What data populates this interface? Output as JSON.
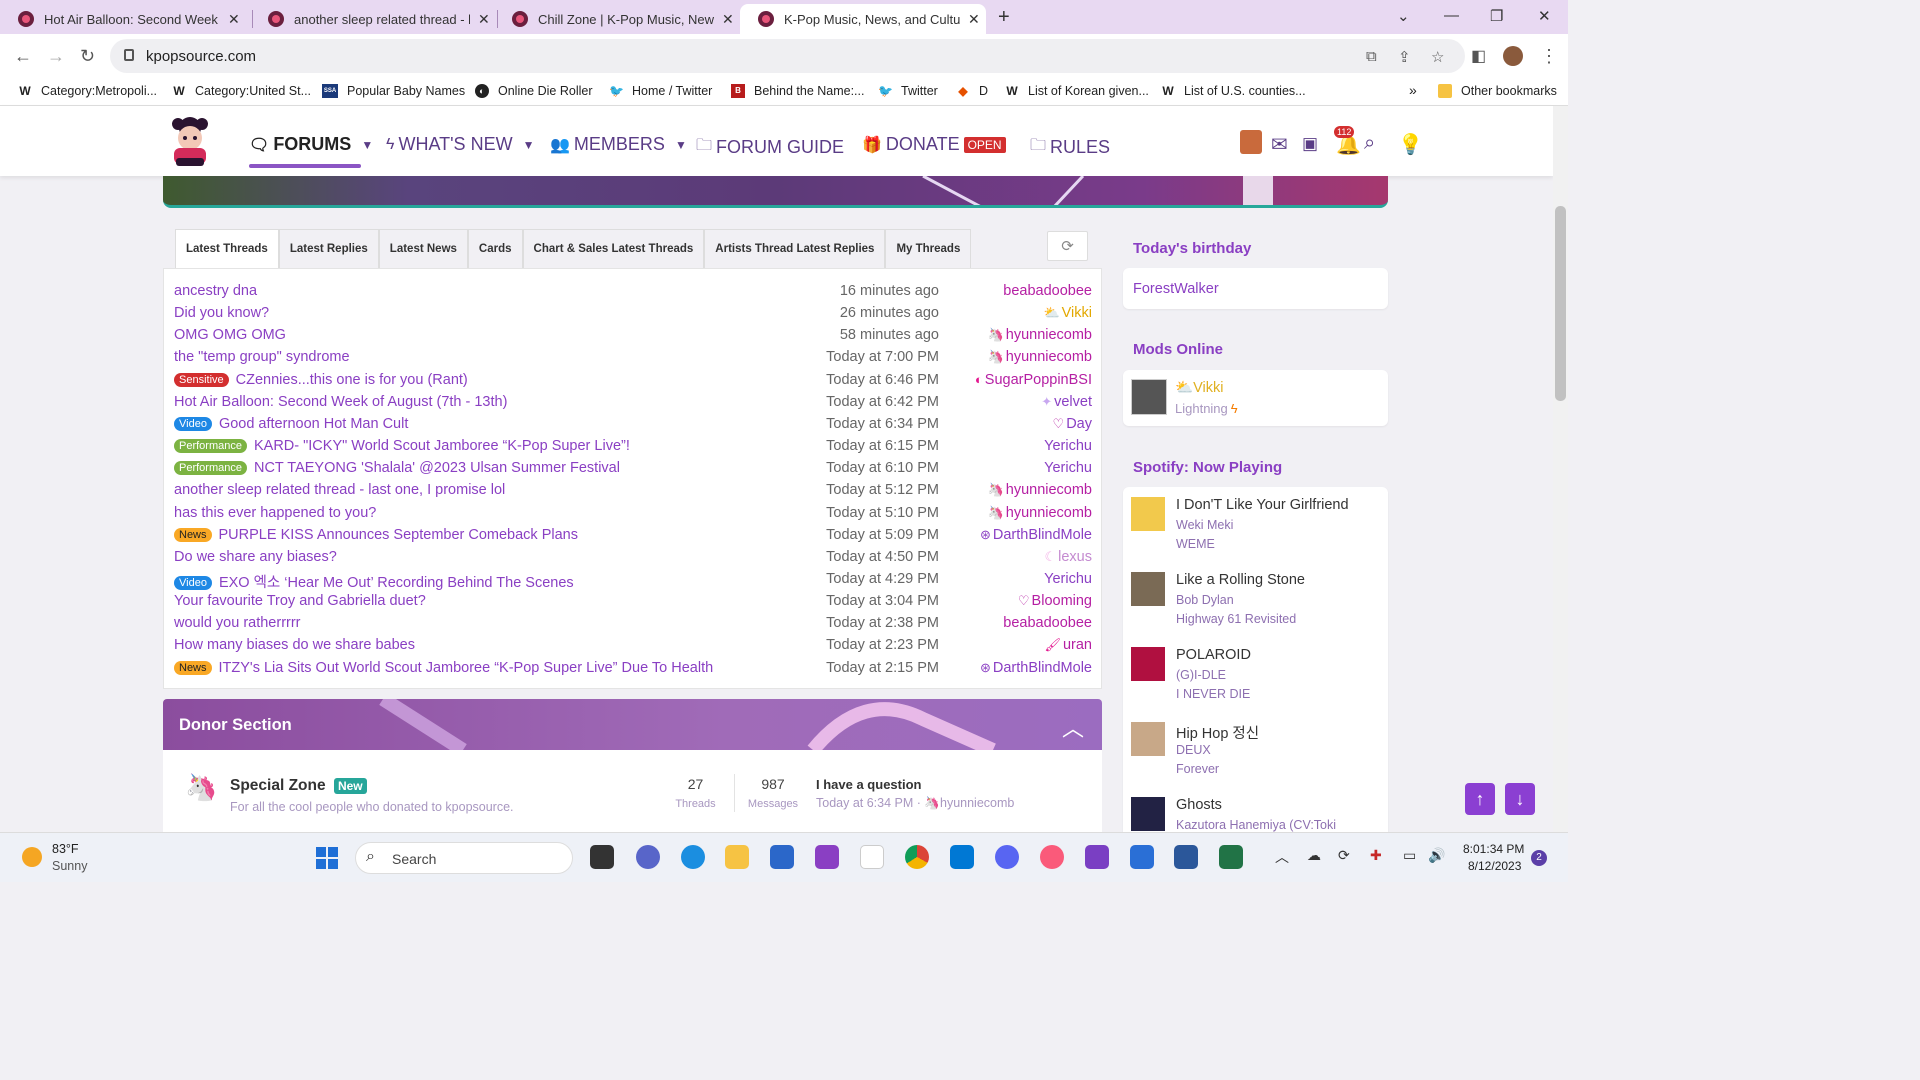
{
  "browser": {
    "tabs": [
      {
        "title": "Hot Air Balloon: Second Week of",
        "active": false
      },
      {
        "title": "another sleep related thread - las",
        "active": false
      },
      {
        "title": "Chill Zone | K-Pop Music, News, a",
        "active": false
      },
      {
        "title": "K-Pop Music, News, and Culture",
        "active": true
      }
    ],
    "new_tab": "+",
    "url": "kpopsource.com",
    "bookmarks": [
      {
        "icon": "W",
        "label": "Category:Metropoli..."
      },
      {
        "icon": "W",
        "label": "Category:United St..."
      },
      {
        "icon": "SSA",
        "label": "Popular Baby Names"
      },
      {
        "icon": "die-icon",
        "label": "Online Die Roller"
      },
      {
        "icon": "twitter-icon",
        "label": "Home / Twitter"
      },
      {
        "icon": "btn-icon",
        "label": "Behind the Name:..."
      },
      {
        "icon": "twitter-icon",
        "label": "Twitter"
      },
      {
        "icon": "d-icon",
        "label": "D"
      },
      {
        "icon": "W",
        "label": "List of Korean given..."
      },
      {
        "icon": "W",
        "label": "List of U.S. counties..."
      }
    ],
    "bookmarks_more": "»",
    "other_bookmarks": "Other bookmarks"
  },
  "site": {
    "nav": {
      "forums": "FORUMS",
      "whats_new": "WHAT'S NEW",
      "members": "MEMBERS",
      "forum_guide": "FORUM GUIDE",
      "donate": "DONATE",
      "donate_badge": "OPEN",
      "rules": "RULES"
    },
    "notification_count": "112",
    "accent_color": "#8a3fc3"
  },
  "threads": {
    "tabs": [
      "Latest Threads",
      "Latest Replies",
      "Latest News",
      "Cards",
      "Chart & Sales Latest Threads",
      "Artists Thread Latest Replies",
      "My Threads"
    ],
    "refresh_icon": "refresh-icon",
    "rows": [
      {
        "badge": "",
        "title": "ancestry dna",
        "time": "16 minutes ago",
        "user": "beabadoobee",
        "user_icon": ""
      },
      {
        "badge": "",
        "title": "Did you know?",
        "time": "26 minutes ago",
        "user": "Vikki",
        "user_icon": "sun-cloud-icon"
      },
      {
        "badge": "",
        "title": "OMG OMG OMG",
        "time": "58 minutes ago",
        "user": "hyunniecomb",
        "user_icon": "unicorn-icon"
      },
      {
        "badge": "",
        "title": "the \"temp group\" syndrome",
        "time": "Today at 7:00 PM",
        "user": "hyunniecomb",
        "user_icon": "unicorn-icon"
      },
      {
        "badge": "Sensitive",
        "title": "CZennies...this one is for you (Rant)",
        "time": "Today at 6:46 PM",
        "user": "SugarPoppinBSI",
        "user_icon": "swirl-icon"
      },
      {
        "badge": "",
        "title": "Hot Air Balloon: Second Week of August (7th - 13th)",
        "time": "Today at 6:42 PM",
        "user": "velvet",
        "user_icon": "star-icon"
      },
      {
        "badge": "Video",
        "title": "Good afternoon Hot Man Cult",
        "time": "Today at 6:34 PM",
        "user": "Day",
        "user_icon": "heart-icon"
      },
      {
        "badge": "Performance",
        "title": "KARD- \"ICKY\" World Scout Jamboree “K-Pop Super Live”!",
        "time": "Today at 6:15 PM",
        "user": "Yerichu",
        "user_icon": ""
      },
      {
        "badge": "Performance",
        "title": "NCT TAEYONG 'Shalala' @2023 Ulsan Summer Festival",
        "time": "Today at 6:10 PM",
        "user": "Yerichu",
        "user_icon": ""
      },
      {
        "badge": "",
        "title": "another sleep related thread - last one, I promise lol",
        "time": "Today at 5:12 PM",
        "user": "hyunniecomb",
        "user_icon": "unicorn-icon"
      },
      {
        "badge": "",
        "title": "has this ever happened to you?",
        "time": "Today at 5:10 PM",
        "user": "hyunniecomb",
        "user_icon": "unicorn-icon"
      },
      {
        "badge": "News",
        "title": "PURPLE KISS Announces September Comeback Plans",
        "time": "Today at 5:09 PM",
        "user": "DarthBlindMole",
        "user_icon": "empire-icon"
      },
      {
        "badge": "",
        "title": "Do we share any biases?",
        "time": "Today at 4:50 PM",
        "user": "lexus",
        "user_icon": "moon-icon"
      },
      {
        "badge": "Video",
        "title": "EXO 엑소 ‘Hear Me Out’ Recording Behind The Scenes",
        "time": "Today at 4:29 PM",
        "user": "Yerichu",
        "user_icon": ""
      },
      {
        "badge": "",
        "title": "Your favourite Troy and Gabriella duet?",
        "time": "Today at 3:04 PM",
        "user": "Blooming",
        "user_icon": "heart-icon"
      },
      {
        "badge": "",
        "title": "would you ratherrrrr",
        "time": "Today at 2:38 PM",
        "user": "beabadoobee",
        "user_icon": ""
      },
      {
        "badge": "",
        "title": "How many biases do we share babes",
        "time": "Today at 2:23 PM",
        "user": "uran",
        "user_icon": "wand-icon"
      },
      {
        "badge": "News",
        "title": "ITZY's Lia Sits Out World Scout Jamboree “K-Pop Super Live” Due To Health",
        "time": "Today at 2:15 PM",
        "user": "DarthBlindMole",
        "user_icon": "empire-icon"
      }
    ]
  },
  "donor": {
    "title": "Donor Section",
    "forum": {
      "name": "Special Zone",
      "badge": "New",
      "desc": "For all the cool people who donated to kpopsource.",
      "threads": "27",
      "threads_label": "Threads",
      "messages": "987",
      "messages_label": "Messages",
      "last_title": "I have a question",
      "last_time": "Today at 6:34 PM",
      "last_sep": "·",
      "last_user": "hyunniecomb"
    }
  },
  "sidebar": {
    "birthday_title": "Today's birthday",
    "birthday_user": "ForestWalker",
    "mods_title": "Mods Online",
    "mod_name": "Vikki",
    "mod_title": "Lightning",
    "spotify_title": "Spotify: Now Playing",
    "songs": [
      {
        "song": "I Don'T Like Your Girlfriend",
        "artist": "Weki Meki",
        "album": "WEME",
        "art": "#f2c94c"
      },
      {
        "song": "Like a Rolling Stone",
        "artist": "Bob Dylan",
        "album": "Highway 61 Revisited",
        "art": "#7a6a55"
      },
      {
        "song": "POLAROID",
        "artist": "(G)I-DLE",
        "album": "I NEVER DIE",
        "art": "#b01040"
      },
      {
        "song": "Hip Hop 정신",
        "artist": "DEUX",
        "album": "Forever",
        "art": "#c8a888"
      },
      {
        "song": "Ghosts",
        "artist": "Kazutora Hanemiya (CV:Toki",
        "album": "",
        "art": "#222244"
      }
    ]
  },
  "taskbar": {
    "weather_temp": "83°F",
    "weather_desc": "Sunny",
    "search_placeholder": "Search",
    "time": "8:01:34 PM",
    "date": "8/12/2023",
    "notif_count": "2"
  }
}
